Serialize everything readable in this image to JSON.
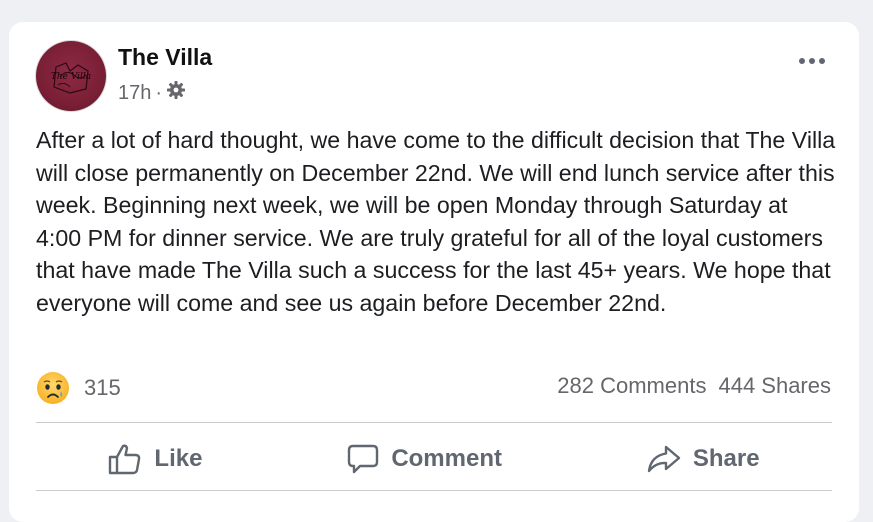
{
  "post": {
    "author": "The Villa",
    "time": "17h",
    "separator": "·",
    "visibility_icon": "gear-icon",
    "avatar_text": "The Villa",
    "body": "After a lot of hard thought, we have come to the difficult decision that The Villa will close permanently on December 22nd. We will end lunch service after this week. Beginning next week, we will be open Monday through Saturday at 4:00 PM for dinner service. We are truly grateful for all of the loyal customers that have made The Villa such a success for the last 45+ years. We hope that everyone will come and see us again before December 22nd."
  },
  "stats": {
    "reaction_icon": "sad-face-icon",
    "reaction_count": "315",
    "comments": "282 Comments",
    "shares": "444 Shares"
  },
  "actions": {
    "like": "Like",
    "comment": "Comment",
    "share": "Share"
  },
  "colors": {
    "background": "#eef0f4",
    "card": "#ffffff",
    "text": "#1c1e21",
    "secondary_text": "#65676b",
    "avatar": "#7a1f36",
    "reaction": "#f7b125"
  }
}
